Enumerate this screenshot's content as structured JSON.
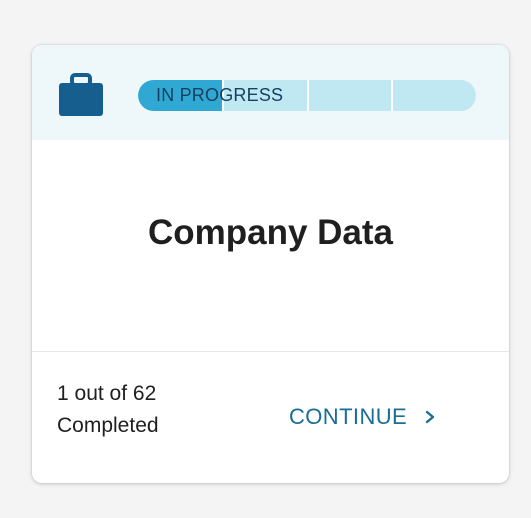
{
  "card": {
    "status_label": "IN PROGRESS",
    "progress_fraction": 0.25,
    "progress_segments": 4,
    "title": "Company Data",
    "completed_line1": "1 out of 62",
    "completed_line2": "Completed",
    "continue_label": "CONTINUE"
  },
  "icons": {
    "header": "briefcase-icon",
    "continue": "chevron-right-icon"
  },
  "colors": {
    "header_bg": "#eef8fb",
    "progress_track": "#bfe8f3",
    "progress_fill": "#2fa9d3",
    "briefcase": "#155e8e",
    "continue_text": "#1a6d96"
  }
}
